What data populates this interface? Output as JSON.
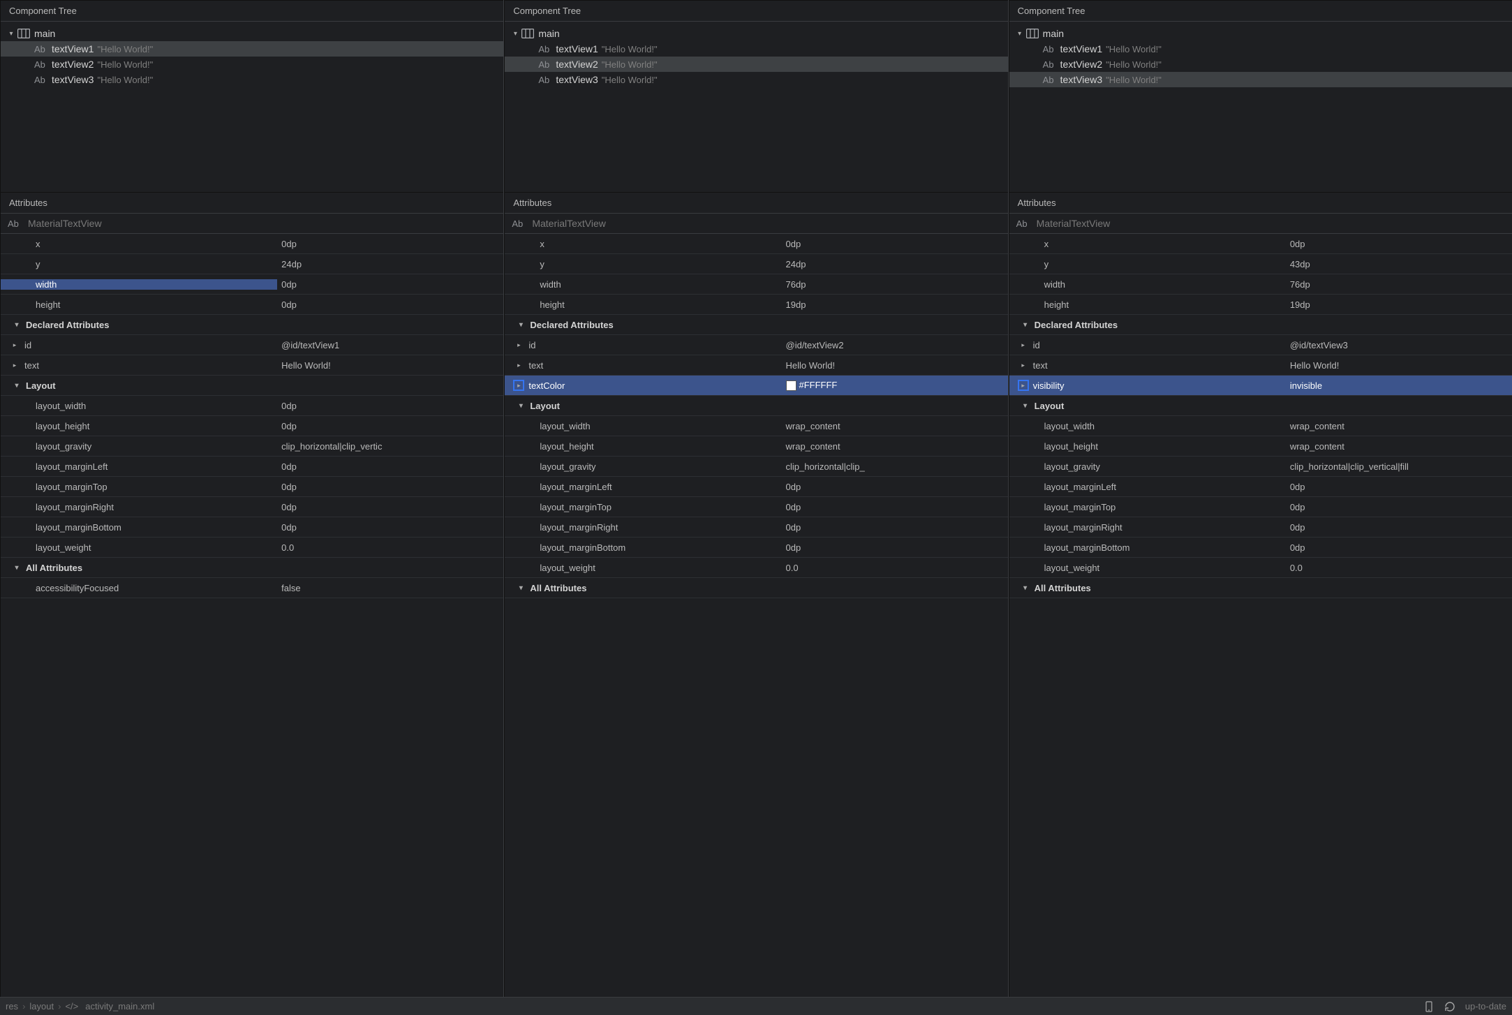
{
  "sectionHeaders": {
    "componentTree": "Component Tree",
    "attributes": "Attributes"
  },
  "labels": {
    "typeName": "MaterialTextView",
    "abIcon": "Ab",
    "declaredAttributes": "Declared Attributes",
    "layout": "Layout",
    "allAttributes": "All Attributes"
  },
  "footer": {
    "crumb1": "res",
    "crumb2": "layout",
    "crumb3": "activity_main.xml",
    "status": "up-to-date"
  },
  "panels": [
    {
      "selectedIndex": 0,
      "tree": {
        "root": {
          "name": "main"
        },
        "children": [
          {
            "name": "textView1",
            "text": "\"Hello World!\""
          },
          {
            "name": "textView2",
            "text": "\"Hello World!\""
          },
          {
            "name": "textView3",
            "text": "\"Hello World!\""
          }
        ]
      },
      "basicAttrs": [
        {
          "key": "x",
          "value": "0dp"
        },
        {
          "key": "y",
          "value": "24dp"
        },
        {
          "key": "width",
          "value": "0dp",
          "highlighted": true
        },
        {
          "key": "height",
          "value": "0dp"
        }
      ],
      "declaredAttrs": [
        {
          "key": "id",
          "value": "@id/textView1",
          "hasChevron": true
        },
        {
          "key": "text",
          "value": "Hello World!",
          "hasChevron": true
        }
      ],
      "highlightedDeclaredIndex": -1,
      "markerDeclaredIndex": -1,
      "layoutAttrs": [
        {
          "key": "layout_width",
          "value": "0dp"
        },
        {
          "key": "layout_height",
          "value": "0dp"
        },
        {
          "key": "layout_gravity",
          "value": "clip_horizontal|clip_vertic"
        },
        {
          "key": "layout_marginLeft",
          "value": "0dp"
        },
        {
          "key": "layout_marginTop",
          "value": "0dp"
        },
        {
          "key": "layout_marginRight",
          "value": "0dp"
        },
        {
          "key": "layout_marginBottom",
          "value": "0dp"
        },
        {
          "key": "layout_weight",
          "value": "0.0"
        }
      ],
      "allAttrsExtra": [
        {
          "key": "accessibilityFocused",
          "value": "false"
        }
      ]
    },
    {
      "selectedIndex": 1,
      "tree": {
        "root": {
          "name": "main"
        },
        "children": [
          {
            "name": "textView1",
            "text": "\"Hello World!\""
          },
          {
            "name": "textView2",
            "text": "\"Hello World!\""
          },
          {
            "name": "textView3",
            "text": "\"Hello World!\""
          }
        ]
      },
      "basicAttrs": [
        {
          "key": "x",
          "value": "0dp"
        },
        {
          "key": "y",
          "value": "24dp"
        },
        {
          "key": "width",
          "value": "76dp"
        },
        {
          "key": "height",
          "value": "19dp"
        }
      ],
      "declaredAttrs": [
        {
          "key": "id",
          "value": "@id/textView2",
          "hasChevron": true
        },
        {
          "key": "text",
          "value": "Hello World!",
          "hasChevron": true
        },
        {
          "key": "textColor",
          "value": "#FFFFFF",
          "hasChevron": true,
          "hasSwatch": true
        }
      ],
      "highlightedDeclaredIndex": 2,
      "markerDeclaredIndex": 2,
      "layoutAttrs": [
        {
          "key": "layout_width",
          "value": "wrap_content"
        },
        {
          "key": "layout_height",
          "value": "wrap_content"
        },
        {
          "key": "layout_gravity",
          "value": "clip_horizontal|clip_"
        },
        {
          "key": "layout_marginLeft",
          "value": "0dp"
        },
        {
          "key": "layout_marginTop",
          "value": "0dp"
        },
        {
          "key": "layout_marginRight",
          "value": "0dp"
        },
        {
          "key": "layout_marginBottom",
          "value": "0dp"
        },
        {
          "key": "layout_weight",
          "value": "0.0"
        }
      ],
      "allAttrsExtra": []
    },
    {
      "selectedIndex": 2,
      "tree": {
        "root": {
          "name": "main"
        },
        "children": [
          {
            "name": "textView1",
            "text": "\"Hello World!\""
          },
          {
            "name": "textView2",
            "text": "\"Hello World!\""
          },
          {
            "name": "textView3",
            "text": "\"Hello World!\""
          }
        ]
      },
      "basicAttrs": [
        {
          "key": "x",
          "value": "0dp"
        },
        {
          "key": "y",
          "value": "43dp"
        },
        {
          "key": "width",
          "value": "76dp"
        },
        {
          "key": "height",
          "value": "19dp"
        }
      ],
      "declaredAttrs": [
        {
          "key": "id",
          "value": "@id/textView3",
          "hasChevron": true
        },
        {
          "key": "text",
          "value": "Hello World!",
          "hasChevron": true
        },
        {
          "key": "visibility",
          "value": "invisible",
          "hasChevron": true
        }
      ],
      "highlightedDeclaredIndex": 2,
      "markerDeclaredIndex": 2,
      "layoutAttrs": [
        {
          "key": "layout_width",
          "value": "wrap_content"
        },
        {
          "key": "layout_height",
          "value": "wrap_content"
        },
        {
          "key": "layout_gravity",
          "value": "clip_horizontal|clip_vertical|fill"
        },
        {
          "key": "layout_marginLeft",
          "value": "0dp"
        },
        {
          "key": "layout_marginTop",
          "value": "0dp"
        },
        {
          "key": "layout_marginRight",
          "value": "0dp"
        },
        {
          "key": "layout_marginBottom",
          "value": "0dp"
        },
        {
          "key": "layout_weight",
          "value": "0.0"
        }
      ],
      "allAttrsExtra": []
    }
  ]
}
